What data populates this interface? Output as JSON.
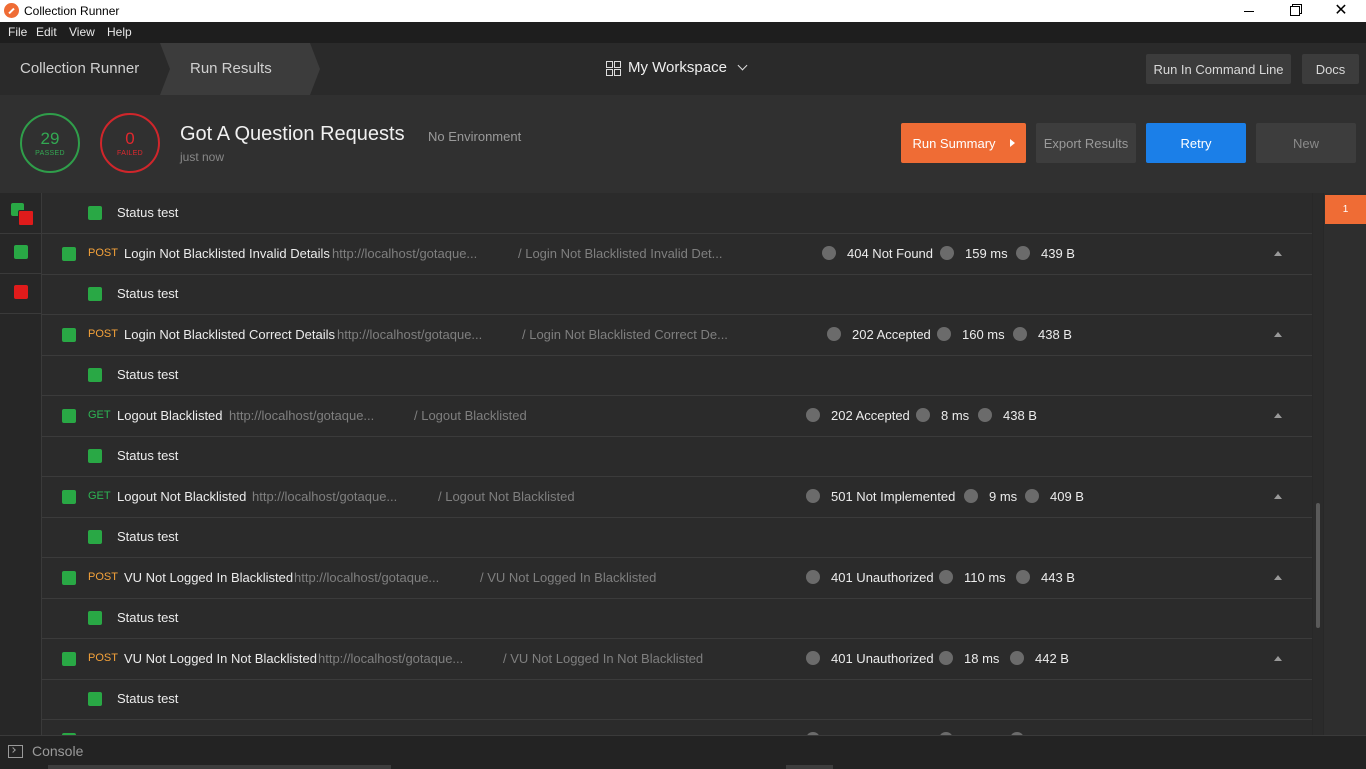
{
  "window": {
    "title": "Collection Runner"
  },
  "menu": [
    "File",
    "Edit",
    "View",
    "Help"
  ],
  "header": {
    "breadcrumb_root": "Collection Runner",
    "breadcrumb_current": "Run Results",
    "workspace": "My Workspace",
    "run_cli": "Run In Command Line",
    "docs": "Docs"
  },
  "summary": {
    "passed_count": "29",
    "passed_label": "PASSED",
    "failed_count": "0",
    "failed_label": "FAILED",
    "title": "Got A Question Requests",
    "environment": "No Environment",
    "time": "just now",
    "run_summary": "Run Summary",
    "export": "Export Results",
    "retry": "Retry",
    "new": "New"
  },
  "test_label": "Status test",
  "requests": [
    {
      "method": "POST",
      "name": "Login Not Blacklisted Invalid Details",
      "url": "http://localhost/gotaque...",
      "path": "/ Login Not Blacklisted Invalid Det...",
      "status": "404 Not Found",
      "time": "159 ms",
      "size": "439 B"
    },
    {
      "method": "POST",
      "name": "Login Not Blacklisted Correct Details",
      "url": "http://localhost/gotaque...",
      "path": "/ Login Not Blacklisted Correct De...",
      "status": "202 Accepted",
      "time": "160 ms",
      "size": "438 B"
    },
    {
      "method": "GET",
      "name": "Logout Blacklisted",
      "url": "http://localhost/gotaque...",
      "path": "/ Logout Blacklisted",
      "status": "202 Accepted",
      "time": "8 ms",
      "size": "438 B"
    },
    {
      "method": "GET",
      "name": "Logout Not Blacklisted",
      "url": "http://localhost/gotaque...",
      "path": "/ Logout Not Blacklisted",
      "status": "501 Not Implemented",
      "time": "9 ms",
      "size": "409 B"
    },
    {
      "method": "POST",
      "name": "VU Not Logged In Blacklisted",
      "url": "http://localhost/gotaque...",
      "path": "/ VU Not Logged In Blacklisted",
      "status": "401 Unauthorized",
      "time": "110 ms",
      "size": "443 B"
    },
    {
      "method": "POST",
      "name": "VU Not Logged In Not Blacklisted",
      "url": "http://localhost/gotaque...",
      "path": "/ VU Not Logged In Not Blacklisted",
      "status": "401 Unauthorized",
      "time": "18 ms",
      "size": "442 B"
    }
  ],
  "iteration_tab": "1",
  "footer": {
    "console": "Console"
  },
  "colors": {
    "accent_orange": "#ef6c35",
    "retry_blue": "#1b7fe8",
    "pass_green": "#29a845",
    "fail_red": "#e01b1b",
    "post_orange": "#f4a23a",
    "get_green": "#2db654"
  }
}
